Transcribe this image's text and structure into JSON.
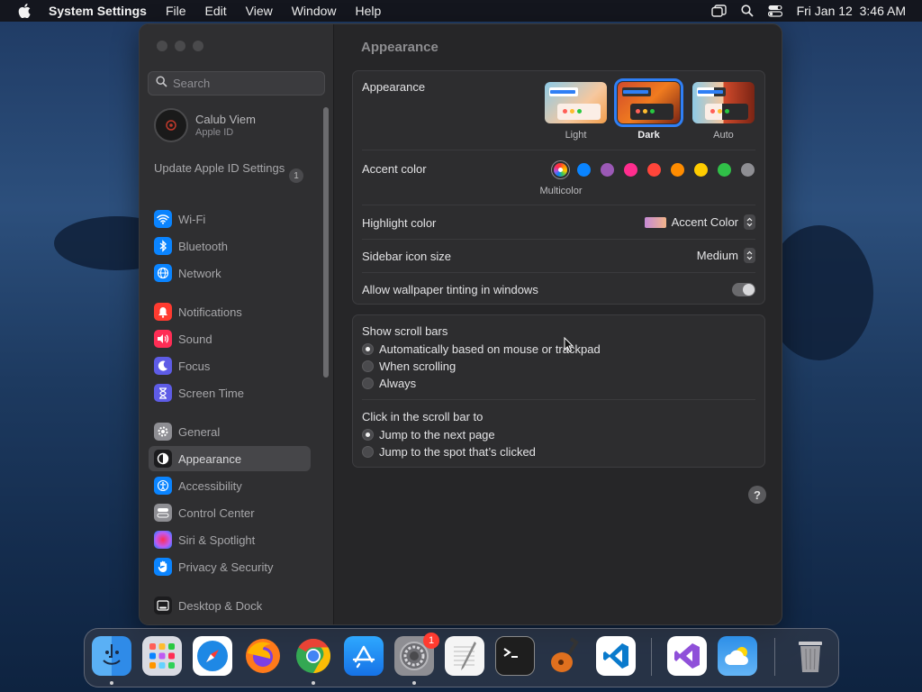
{
  "menubar": {
    "app_name": "System Settings",
    "menus": [
      "File",
      "Edit",
      "View",
      "Window",
      "Help"
    ],
    "datetime": "Fri Jan 12  3:46 AM"
  },
  "sidebar": {
    "search_placeholder": "Search",
    "account": {
      "name": "Calub Viem",
      "subtitle": "Apple ID"
    },
    "update": {
      "label": "Update Apple ID Settings",
      "badge": "1"
    },
    "items": [
      {
        "label": "Wi-Fi",
        "icon": "wifi-icon",
        "color": "#0a84ff"
      },
      {
        "label": "Bluetooth",
        "icon": "bluetooth-icon",
        "color": "#0a84ff"
      },
      {
        "label": "Network",
        "icon": "globe-icon",
        "color": "#0a84ff"
      },
      {
        "label": "Notifications",
        "icon": "bell-icon",
        "color": "#ff3b30"
      },
      {
        "label": "Sound",
        "icon": "speaker-icon",
        "color": "#ff2d55"
      },
      {
        "label": "Focus",
        "icon": "moon-icon",
        "color": "#5e5ce6"
      },
      {
        "label": "Screen Time",
        "icon": "hourglass-icon",
        "color": "#5e5ce6"
      },
      {
        "label": "General",
        "icon": "gear-icon",
        "color": "#8e8e93"
      },
      {
        "label": "Appearance",
        "icon": "appearance-icon",
        "color": "#1c1c1e"
      },
      {
        "label": "Accessibility",
        "icon": "accessibility-icon",
        "color": "#0a84ff"
      },
      {
        "label": "Control Center",
        "icon": "control-center-icon",
        "color": "#8e8e93"
      },
      {
        "label": "Siri & Spotlight",
        "icon": "siri-icon",
        "color": "#bf5af2"
      },
      {
        "label": "Privacy & Security",
        "icon": "hand-icon",
        "color": "#0a84ff"
      },
      {
        "label": "Desktop & Dock",
        "icon": "dock-icon",
        "color": "#1c1c1e"
      }
    ]
  },
  "main": {
    "title": "Appearance",
    "appearance": {
      "label": "Appearance",
      "options": [
        {
          "label": "Light",
          "selected": false
        },
        {
          "label": "Dark",
          "selected": true
        },
        {
          "label": "Auto",
          "selected": false
        }
      ]
    },
    "accent": {
      "label": "Accent color",
      "selected_label": "Multicolor",
      "colors": [
        "multicolor",
        "#0a84ff",
        "#9b59b6",
        "#ff2d8e",
        "#ff453a",
        "#ff8c00",
        "#ffcc00",
        "#30c048",
        "#8e8e93"
      ]
    },
    "highlight": {
      "label": "Highlight color",
      "value": "Accent Color"
    },
    "sidebar_icon_size": {
      "label": "Sidebar icon size",
      "value": "Medium"
    },
    "wallpaper_tinting": {
      "label": "Allow wallpaper tinting in windows",
      "on": false
    },
    "scroll_bars": {
      "label": "Show scroll bars",
      "options": [
        {
          "label": "Automatically based on mouse or trackpad",
          "selected": true
        },
        {
          "label": "When scrolling",
          "selected": false
        },
        {
          "label": "Always",
          "selected": false
        }
      ]
    },
    "click_scroll": {
      "label": "Click in the scroll bar to",
      "options": [
        {
          "label": "Jump to the next page",
          "selected": true
        },
        {
          "label": "Jump to the spot that’s clicked",
          "selected": false
        }
      ]
    },
    "help_label": "?"
  },
  "dock": {
    "apps": [
      {
        "name": "finder-icon",
        "running": true
      },
      {
        "name": "launchpad-icon",
        "running": false
      },
      {
        "name": "safari-icon",
        "running": false
      },
      {
        "name": "firefox-icon",
        "running": false
      },
      {
        "name": "chrome-icon",
        "running": true
      },
      {
        "name": "app-store-icon",
        "running": false
      },
      {
        "name": "system-settings-icon",
        "running": true,
        "badge": "1"
      },
      {
        "name": "textedit-icon",
        "running": false
      },
      {
        "name": "terminal-icon",
        "running": false
      },
      {
        "name": "garageband-icon",
        "running": false
      },
      {
        "name": "vscode-icon",
        "running": false
      },
      {
        "name": "visual-studio-icon",
        "running": false
      },
      {
        "name": "weather-icon",
        "running": false
      },
      {
        "name": "trash-icon",
        "running": false
      }
    ]
  }
}
